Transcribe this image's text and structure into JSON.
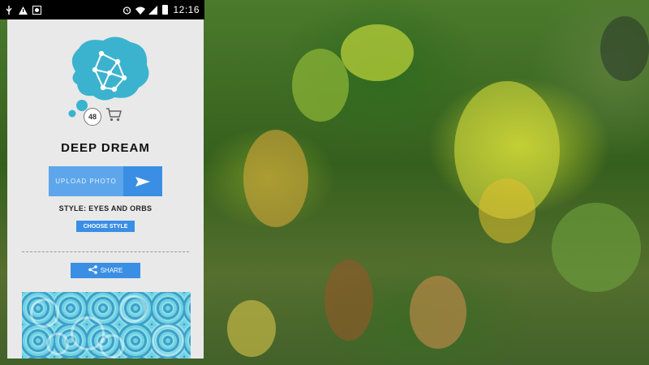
{
  "statusbar": {
    "left_icons": [
      "usb-icon",
      "warning-icon",
      "image-icon"
    ],
    "right_icons": [
      "alarm-icon",
      "wifi-icon",
      "signal-icon",
      "battery-icon"
    ],
    "time": "12:16"
  },
  "app": {
    "photo_count": "48",
    "title": "DEEP DREAM",
    "upload_label": "UPLOAD PHOTO",
    "style_label": "STYLE: EYES AND ORBS",
    "choose_style_label": "CHOOSE STYLE",
    "share_label": "SHARE"
  },
  "colors": {
    "accent": "#3a8ee4",
    "accent_light": "#5da6ec",
    "logo": "#3bb3cf",
    "panel": "#e9e9e9"
  }
}
